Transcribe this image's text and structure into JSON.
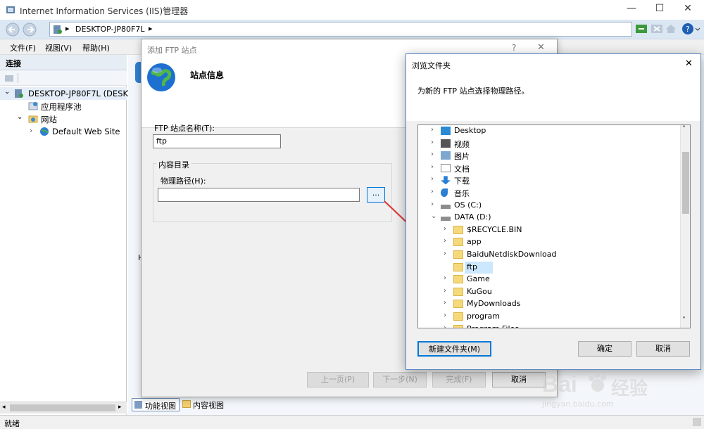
{
  "window": {
    "title": "Internet Information Services (IIS)管理器",
    "minimize": "—",
    "maximize": "☐",
    "close": "✕",
    "address": "DESKTOP-JP80F7L",
    "address_sep": "▸"
  },
  "menu": {
    "file": "文件(F)",
    "view": "视图(V)",
    "help": "帮助(H)"
  },
  "connections": {
    "header": "连接",
    "tree": [
      {
        "label": "DESKTOP-JP80F7L (DESKTO",
        "chevron": "⌄"
      },
      {
        "label": "应用程序池"
      },
      {
        "label": "网站",
        "chevron": "⌄"
      },
      {
        "label": "Default Web Site",
        "chevron": "›"
      }
    ]
  },
  "main": {
    "side_letter": "H"
  },
  "view_tabs": {
    "features": "功能视图",
    "content": "内容视图"
  },
  "status": {
    "text": "就绪"
  },
  "ftp_dialog": {
    "title": "添加 FTP 站点",
    "help": "?",
    "close": "✕",
    "heading": "站点信息",
    "site_name_label": "FTP 站点名称(T):",
    "site_name_value": "ftp",
    "content_dir_label": "内容目录",
    "physical_path_label": "物理路径(H):",
    "physical_path_value": "",
    "browse_button": "...",
    "buttons": {
      "prev": "上一页(P)",
      "next": "下一步(N)",
      "finish": "完成(F)",
      "cancel": "取消"
    }
  },
  "browse_dialog": {
    "title": "浏览文件夹",
    "close": "✕",
    "description": "为新的 FTP 站点选择物理路径。",
    "new_folder_button": "新建文件夹(M)",
    "ok_button": "确定",
    "cancel_button": "取消",
    "items": [
      {
        "label": "Desktop",
        "chevron": "›",
        "icon": "desktop-icon",
        "level": 0
      },
      {
        "label": "视频",
        "chevron": "›",
        "icon": "video-icon",
        "level": 0
      },
      {
        "label": "图片",
        "chevron": "›",
        "icon": "pictures-icon",
        "level": 0
      },
      {
        "label": "文档",
        "chevron": "›",
        "icon": "documents-icon",
        "level": 0
      },
      {
        "label": "下载",
        "chevron": "›",
        "icon": "downloads-icon",
        "level": 0
      },
      {
        "label": "音乐",
        "chevron": "›",
        "icon": "music-icon",
        "level": 0
      },
      {
        "label": "OS (C:)",
        "chevron": "›",
        "icon": "drive-icon",
        "level": 0
      },
      {
        "label": "DATA (D:)",
        "chevron": "⌄",
        "icon": "drive-icon",
        "level": 0
      },
      {
        "label": "$RECYCLE.BIN",
        "chevron": "›",
        "icon": "folder-icon",
        "level": 1
      },
      {
        "label": "app",
        "chevron": "›",
        "icon": "folder-icon",
        "level": 1
      },
      {
        "label": "BaiduNetdiskDownload",
        "chevron": "›",
        "icon": "folder-icon",
        "level": 1
      },
      {
        "label": "ftp",
        "chevron": "",
        "icon": "folder-icon",
        "level": 1,
        "selected": true
      },
      {
        "label": "Game",
        "chevron": "›",
        "icon": "folder-icon",
        "level": 1
      },
      {
        "label": "KuGou",
        "chevron": "›",
        "icon": "folder-icon",
        "level": 1
      },
      {
        "label": "MyDownloads",
        "chevron": "›",
        "icon": "folder-icon",
        "level": 1
      },
      {
        "label": "program",
        "chevron": "›",
        "icon": "folder-icon",
        "level": 1
      },
      {
        "label": "Program Files",
        "chevron": "›",
        "icon": "folder-icon",
        "level": 1
      }
    ],
    "scroll_up": "˄",
    "scroll_down": "˅"
  },
  "watermark": {
    "brand": "Bai",
    "brand2": "经验",
    "url": "jingyan.baidu.com"
  },
  "colors": {
    "accent": "#0078d7",
    "arrow": "#e03030",
    "selected": "#cce8ff"
  }
}
